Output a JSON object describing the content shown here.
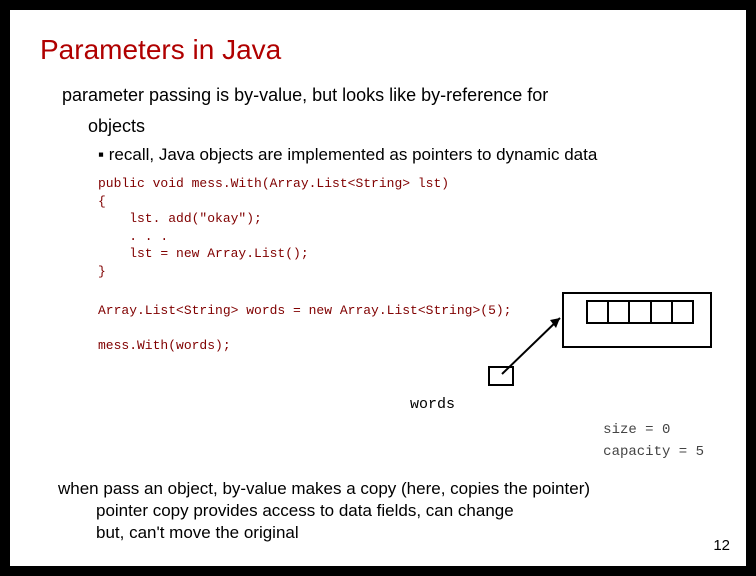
{
  "title": "Parameters in Java",
  "intro_line1": "parameter passing is by-value, but looks like by-reference for",
  "intro_line2": "objects",
  "bullet_square": "▪",
  "sub_bullet": "recall, Java objects are implemented as pointers to dynamic data",
  "code_block1": "public void mess.With(Array.List<String> lst)\n{\n    lst. add(\"okay\");\n    . . .\n    lst = new Array.List();\n}",
  "code_block2": "Array.List<String> words = new Array.List<String>(5);\n\nmess.With(words);",
  "words_label": "words",
  "size_label": "size = 0",
  "capacity_label": "capacity = 5",
  "bottom_line1": "when pass an object, by-value makes a copy (here, copies the pointer)",
  "bottom_line2": "pointer copy provides access to data fields, can change",
  "bottom_line3": "but, can't move the original",
  "page_number": "12"
}
